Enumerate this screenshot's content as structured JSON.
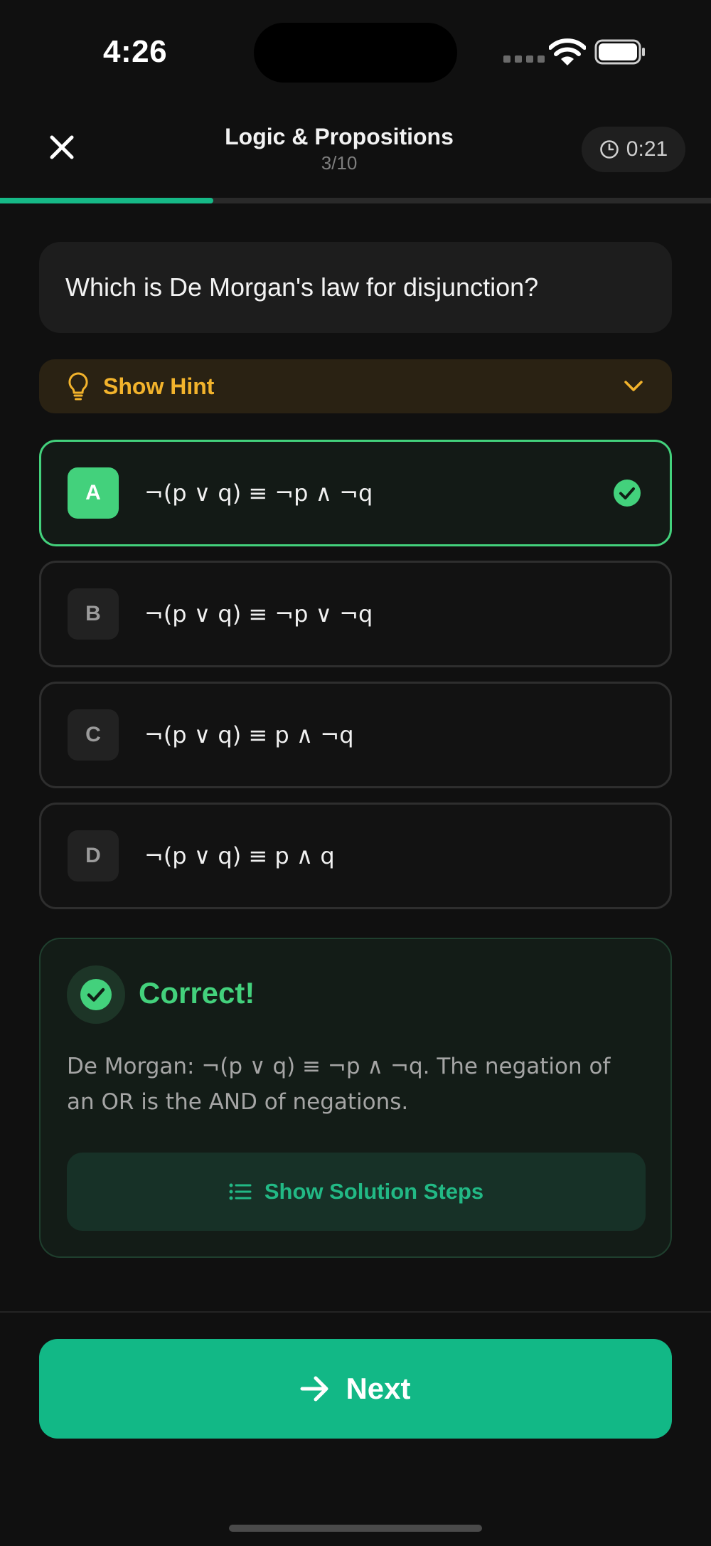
{
  "status_bar": {
    "time": "4:26"
  },
  "header": {
    "title": "Logic & Propositions",
    "counter": "3/10",
    "timer": "0:21",
    "progress_fraction": 0.3
  },
  "question": {
    "text": "Which is De Morgan's law for disjunction?"
  },
  "hint": {
    "label": "Show Hint"
  },
  "options": [
    {
      "letter": "A",
      "text": "¬(p ∨ q) ≡ ¬p ∧ ¬q",
      "selected": true
    },
    {
      "letter": "B",
      "text": "¬(p ∨ q) ≡ ¬p ∨ ¬q",
      "selected": false
    },
    {
      "letter": "C",
      "text": "¬(p ∨ q) ≡ p ∧ ¬q",
      "selected": false
    },
    {
      "letter": "D",
      "text": "¬(p ∨ q) ≡ p ∧ q",
      "selected": false
    }
  ],
  "feedback": {
    "title": "Correct!",
    "explanation": "De Morgan: ¬(p ∨ q) ≡ ¬p ∧ ¬q. The negation of an OR is the AND of negations.",
    "steps_label": "Show Solution Steps"
  },
  "footer": {
    "next_label": "Next"
  },
  "colors": {
    "accent": "#12b886",
    "correct": "#43d17c",
    "hint": "#f2b32c"
  }
}
